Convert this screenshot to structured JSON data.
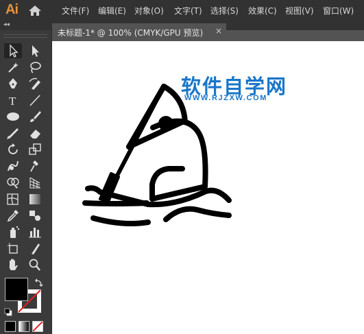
{
  "app": {
    "logo": "Ai"
  },
  "menu": {
    "items": [
      {
        "label": "文件(F)"
      },
      {
        "label": "编辑(E)"
      },
      {
        "label": "对象(O)"
      },
      {
        "label": "文字(T)"
      },
      {
        "label": "选择(S)"
      },
      {
        "label": "效果(C)"
      },
      {
        "label": "视图(V)"
      },
      {
        "label": "窗口(W)"
      }
    ]
  },
  "document_tab": {
    "title": "未标题-1* @ 100% (CMYK/GPU 预览)",
    "close": "×"
  },
  "panel": {
    "collapse": "◂◂"
  },
  "watermark": {
    "title": "软件自学网",
    "url": "WWW.RJZXW.COM"
  },
  "colors": {
    "fill": "#000000",
    "stroke": "none",
    "accent": "#1976c9",
    "logo": "#e8923b",
    "canvas": "#ffffff"
  },
  "tools": [
    "selection-tool",
    "direct-selection-tool",
    "magic-wand-tool",
    "lasso-tool",
    "pen-tool",
    "curvature-tool",
    "type-tool",
    "line-segment-tool",
    "ellipse-tool",
    "paintbrush-tool",
    "pencil-tool",
    "eraser-tool",
    "rotate-tool",
    "scale-tool",
    "warp-tool",
    "puppet-warp-tool",
    "shape-builder-tool",
    "perspective-grid-tool",
    "mesh-tool",
    "gradient-tool",
    "eyedropper-tool",
    "blend-tool",
    "symbol-sprayer-tool",
    "column-graph-tool",
    "artboard-tool",
    "slice-tool",
    "hand-tool",
    "zoom-tool"
  ]
}
